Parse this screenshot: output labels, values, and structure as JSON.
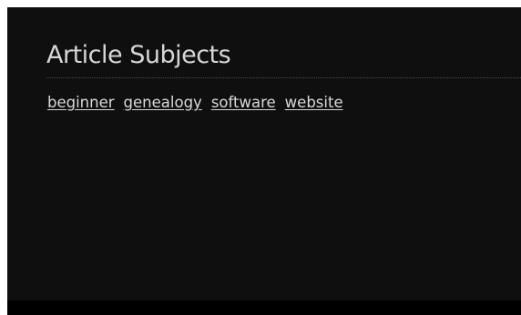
{
  "widget": {
    "title": "Article Subjects",
    "tags": [
      "beginner",
      "genealogy",
      "software",
      "website"
    ]
  }
}
